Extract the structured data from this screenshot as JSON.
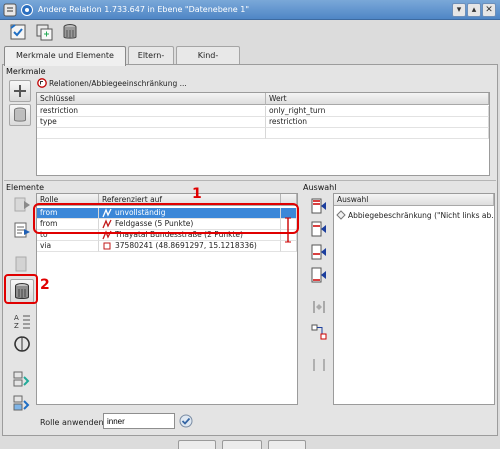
{
  "window": {
    "title": "Andere Relation 1.733.647 in Ebene \"Datenebene 1\""
  },
  "tabs": [
    "Merkmale und Elemente",
    "Eltern-Relationen",
    "Kind-Relationen"
  ],
  "tags": {
    "section_label": "Merkmale",
    "preset_text": "Relationen/Abbiegeeinschränkung ...",
    "columns": [
      "Schlüssel",
      "Wert"
    ],
    "rows": [
      {
        "key": "restriction",
        "value": "only_right_turn"
      },
      {
        "key": "type",
        "value": "restriction"
      }
    ]
  },
  "members": {
    "section_label": "Elemente",
    "columns": [
      "Rolle",
      "Referenziert auf"
    ],
    "rows": [
      {
        "role": "from",
        "ref": "unvollständig",
        "selected": true
      },
      {
        "role": "from",
        "ref": "Feldgasse (5 Punkte)",
        "selected": false
      },
      {
        "role": "to",
        "ref": "Thayatal Bundesstraße (2 Punkte)",
        "selected": false
      },
      {
        "role": "via",
        "ref": "37580241 (48.8691297, 15.1218336)",
        "selected": false
      }
    ],
    "role_apply_label": "Rolle anwenden:",
    "role_input": "inner"
  },
  "selection": {
    "section_label": "Auswahl",
    "column": "Auswahl",
    "rows": [
      "Abbiegebeschränkung (\"Nicht links ab..."
    ]
  },
  "annotations": {
    "label1": "1",
    "label2": "2"
  },
  "colors": {
    "selection": "#3b87d8",
    "annotation": "#e00000",
    "titlebar": "#4f86c6"
  }
}
